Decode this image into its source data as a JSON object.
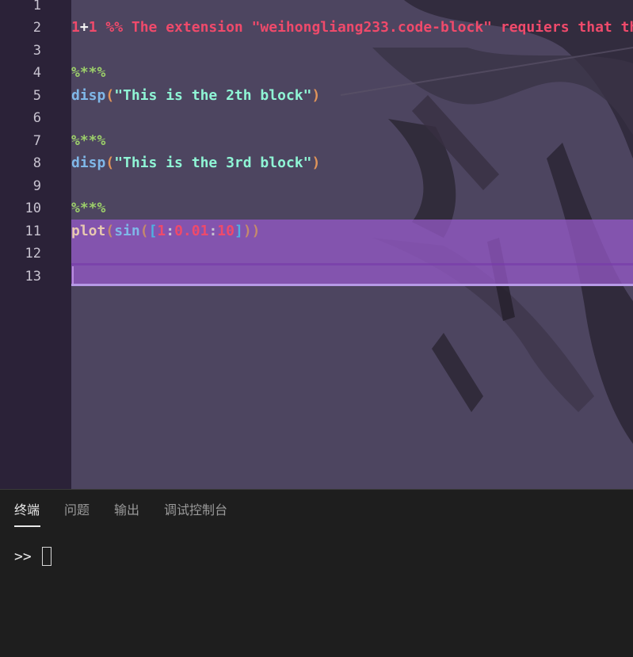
{
  "editor": {
    "line_numbers": [
      "1",
      "2",
      "3",
      "4",
      "5",
      "6",
      "7",
      "8",
      "9",
      "10",
      "11",
      "12",
      "13"
    ],
    "lines": {
      "l1": "%% The extension \"weihongliang233.code-block\" requiers that th",
      "l2_a": "1",
      "l2_b": "+",
      "l2_c": "1",
      "l4": "%**%",
      "l5_fn": "disp",
      "l5_open": "(",
      "l5_str": "\"This is the 2th block\"",
      "l5_close": ")",
      "l7": "%**%",
      "l8_fn": "disp",
      "l8_open": "(",
      "l8_str": "\"This is the 3rd block\"",
      "l8_close": ")",
      "l10": "%**%",
      "l11_fn": "plot",
      "l11_open": "(",
      "l11_fn2": "sin",
      "l11_open2": "(",
      "l11_lb": "[",
      "l11_n1": "1",
      "l11_c1": ":",
      "l11_n2": "0.01",
      "l11_c2": ":",
      "l11_n3": "10",
      "l11_rb": "]",
      "l11_close2": ")",
      "l11_close": ")"
    }
  },
  "panel": {
    "tabs": [
      "终端",
      "问题",
      "输出",
      "调试控制台"
    ],
    "active_tab": "终端",
    "prompt": ">>"
  },
  "colors": {
    "editor_bg": "#4d4560",
    "gutter_bg": "#2b2238",
    "selection": "#965ac8",
    "panel_bg": "#1e1e1e"
  }
}
